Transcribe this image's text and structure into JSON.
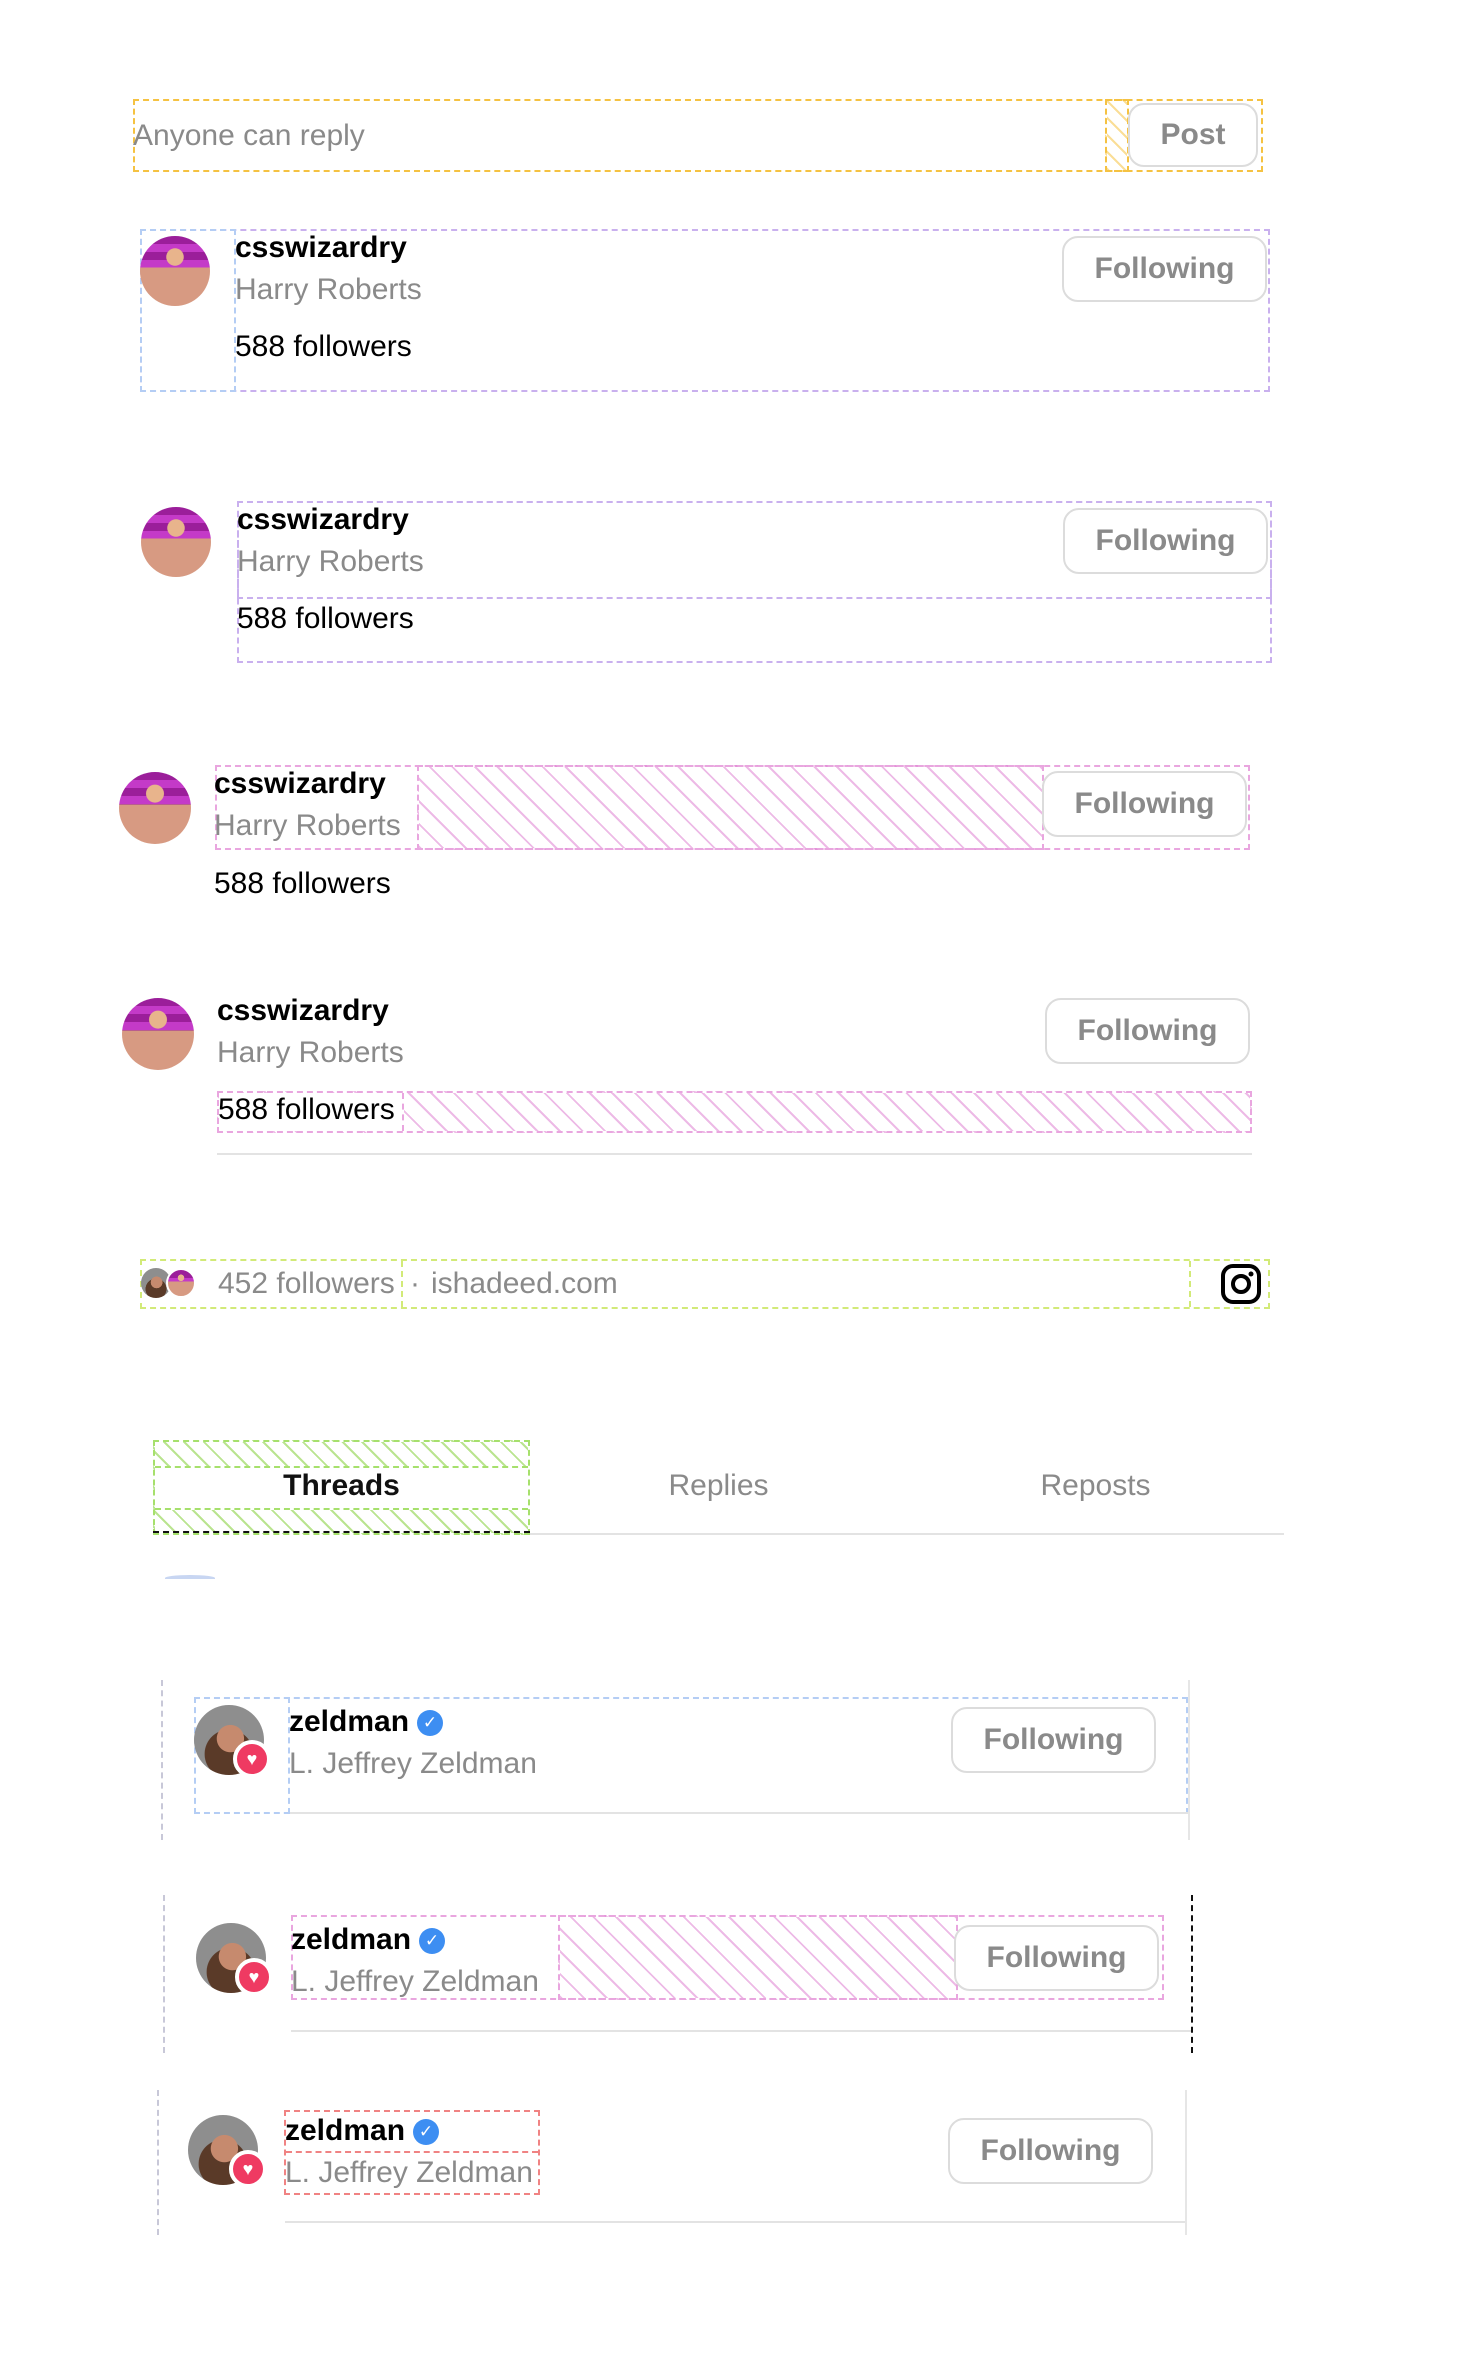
{
  "reply_bar": {
    "placeholder": "Anyone can reply",
    "post_label": "Post"
  },
  "profile": {
    "username": "csswizardry",
    "display_name": "Harry Roberts",
    "followers": "588 followers",
    "follow_label": "Following"
  },
  "profile_meta": {
    "followers": "452 followers",
    "separator": "·",
    "link": "ishadeed.com",
    "icon": "instagram-icon"
  },
  "tabs": [
    {
      "label": "Threads"
    },
    {
      "label": "Replies"
    },
    {
      "label": "Reposts"
    }
  ],
  "zeldman": {
    "username": "zeldman",
    "display_name": "L. Jeffrey Zeldman",
    "follow_label": "Following",
    "badge_icon": "verified-icon",
    "activity_icon": "heart-icon"
  },
  "colors": {
    "accent_verified": "#3d8ef2",
    "heart": "#ef3a62",
    "muted_text": "#8a8a8a",
    "border": "#dcdcdc"
  }
}
